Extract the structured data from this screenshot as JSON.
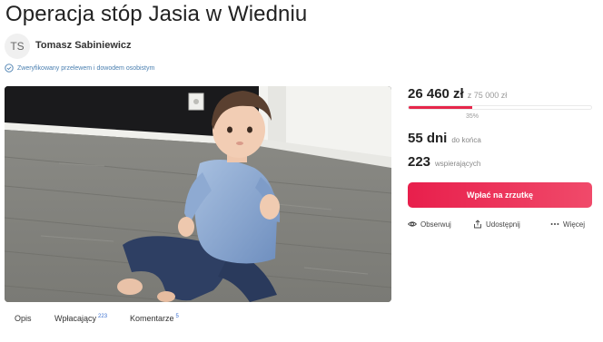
{
  "campaign": {
    "title": "Operacja stóp Jasia w Wiedniu",
    "author_initials": "TS",
    "author_name": "Tomasz Sabiniewicz",
    "verified_text": "Zweryfikowany przelewem i dowodem osobistym"
  },
  "funding": {
    "raised": "26 460 zł",
    "goal": "z 75 000 zł",
    "progress_fraction": 0.35,
    "percent_label": "35%",
    "days_value": "55 dni",
    "days_label": "do końca",
    "supporters_value": "223",
    "supporters_label": "wspierających"
  },
  "actions": {
    "donate_label": "Wpłać na zrzutkę",
    "follow_label": "Obserwuj",
    "share_label": "Udostępnij",
    "more_label": "Więcej"
  },
  "tabs": [
    {
      "label": "Opis",
      "count": ""
    },
    {
      "label": "Wpłacający",
      "count": "223"
    },
    {
      "label": "Komentarze",
      "count": "5"
    }
  ],
  "colors": {
    "accent": "#e6264a",
    "verified": "#4a7fb0",
    "tab_count": "#3a6fd0"
  },
  "icons": {
    "verified": "check-circle-icon",
    "follow": "eye-icon",
    "share": "share-icon",
    "more": "more-dots-icon"
  }
}
